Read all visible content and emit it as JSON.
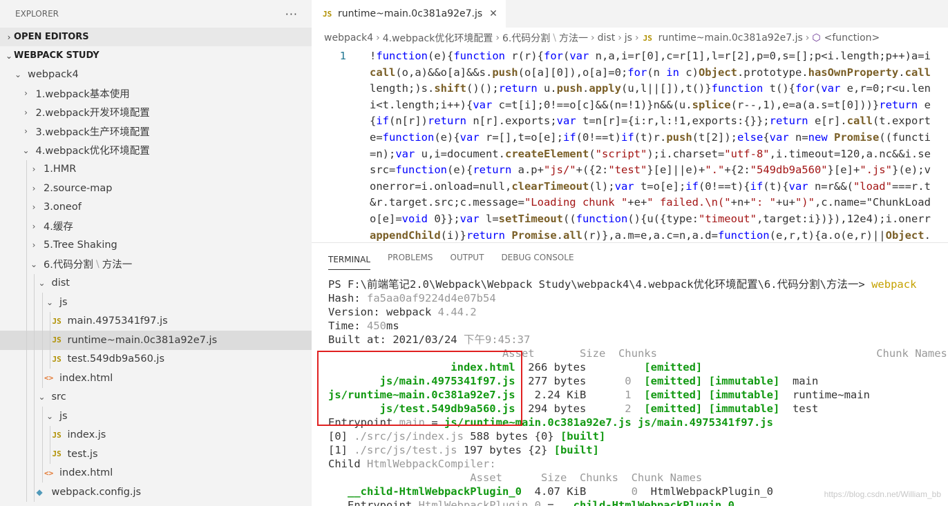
{
  "explorer": {
    "title": "EXPLORER",
    "more": "···",
    "open_editors": "OPEN EDITORS",
    "workspace": "WEBPACK STUDY",
    "tree": [
      {
        "label": "webpack4",
        "type": "folder-open",
        "indent": 0
      },
      {
        "label": "1.webpack基本使用",
        "type": "folder",
        "indent": 1
      },
      {
        "label": "2.webpack开发环境配置",
        "type": "folder",
        "indent": 1
      },
      {
        "label": "3.webpack生产环境配置",
        "type": "folder",
        "indent": 1
      },
      {
        "label": "4.webpack优化环境配置",
        "type": "folder-open",
        "indent": 1
      },
      {
        "label": "1.HMR",
        "type": "folder",
        "indent": 2
      },
      {
        "label": "2.source-map",
        "type": "folder",
        "indent": 2
      },
      {
        "label": "3.oneof",
        "type": "folder",
        "indent": 2
      },
      {
        "label": "4.缓存",
        "type": "folder",
        "indent": 2
      },
      {
        "label": "5.Tree Shaking",
        "type": "folder",
        "indent": 2
      },
      {
        "label": "6.代码分割",
        "suffix": "方法一",
        "type": "folder-open",
        "indent": 2
      },
      {
        "label": "dist",
        "type": "folder-open",
        "indent": 3
      },
      {
        "label": "js",
        "type": "folder-open",
        "indent": 4
      },
      {
        "label": "main.4975341f97.js",
        "type": "js",
        "indent": 5
      },
      {
        "label": "runtime~main.0c381a92e7.js",
        "type": "js",
        "indent": 5,
        "selected": true
      },
      {
        "label": "test.549db9a560.js",
        "type": "js",
        "indent": 5
      },
      {
        "label": "index.html",
        "type": "html",
        "indent": 4
      },
      {
        "label": "src",
        "type": "folder-open",
        "indent": 3
      },
      {
        "label": "js",
        "type": "folder-open",
        "indent": 4
      },
      {
        "label": "index.js",
        "type": "js",
        "indent": 5
      },
      {
        "label": "test.js",
        "type": "js",
        "indent": 5
      },
      {
        "label": "index.html",
        "type": "html",
        "indent": 4
      },
      {
        "label": "webpack.config.js",
        "type": "config",
        "indent": 3
      }
    ]
  },
  "tab": {
    "icon": "JS",
    "label": "runtime~main.0c381a92e7.js",
    "close": "✕"
  },
  "breadcrumb": [
    "webpack4",
    "4.webpack优化环境配置",
    "6.代码分割",
    "方法一",
    "dist",
    "js",
    "runtime~main.0c381a92e7.js",
    "<function>"
  ],
  "code": {
    "line_number": "1",
    "lines": [
      "!function(e){function r(r){for(var n,a,i=r[0],c=r[1],l=r[2],p=0,s=[];p<i.length;p++)a=i",
      "call(o,a)&&o[a]&&s.push(o[a][0]),o[a]=0;for(n in c)Object.prototype.hasOwnProperty.call",
      "length;)s.shift()();return u.push.apply(u,l||[]),t()}function t(){for(var e,r=0;r<u.len",
      "i<t.length;i++){var c=t[i];0!==o[c]&&(n=!1)}n&&(u.splice(r--,1),e=a(a.s=t[0]))}return e",
      "{if(n[r])return n[r].exports;var t=n[r]={i:r,l:!1,exports:{}};return e[r].call(t.export",
      "e=function(e){var r=[],t=o[e];if(0!==t)if(t)r.push(t[2]);else{var n=new Promise((functi",
      "=n);var u,i=document.createElement(\"script\");i.charset=\"utf-8\",i.timeout=120,a.nc&&i.se",
      "src=function(e){return a.p+\"js/\"+({2:\"test\"}[e]||e)+\".\"+{2:\"549db9a560\"}[e]+\".js\"}(e);v",
      "onerror=i.onload=null,clearTimeout(l);var t=o[e];if(0!==t){if(t){var n=r&&(\"load\"===r.t",
      "&r.target.src;c.message=\"Loading chunk \"+e+\" failed.\\n(\"+n+\": \"+u+\")\",c.name=\"ChunkLoad",
      "o[e]=void 0}};var l=setTimeout((function(){u({type:\"timeout\",target:i})}),12e4);i.onerr",
      "appendChild(i)}return Promise.all(r)},a.m=e,a.c=n,a.d=function(e,r,t){a.o(e,r)||Object."
    ]
  },
  "panel": {
    "tabs": [
      "TERMINAL",
      "PROBLEMS",
      "OUTPUT",
      "DEBUG CONSOLE"
    ],
    "active": "TERMINAL"
  },
  "terminal": {
    "prompt": "PS F:\\前端笔记2.0\\Webpack\\Webpack Study\\webpack4\\4.webpack优化环境配置\\6.代码分割\\方法一>",
    "command": "webpack",
    "hash_label": "Hash:",
    "hash": "fa5aa0af9224d4e07b54",
    "version_label": "Version: webpack",
    "version": "4.44.2",
    "time_label": "Time:",
    "time": "450",
    "time_unit": "ms",
    "built_label": "Built at: 2021/03/24",
    "built_time": "下午9:45:37",
    "headers": {
      "asset": "Asset",
      "size": "Size",
      "chunks": "Chunks",
      "names": "Chunk Names"
    },
    "assets": [
      {
        "asset": "index.html",
        "size": "266 bytes",
        "chunk": "",
        "emitted": "[emitted]",
        "immutable": "",
        "name": ""
      },
      {
        "asset": "js/main.4975341f97.js",
        "size": "277 bytes",
        "chunk": "0",
        "emitted": "[emitted]",
        "immutable": "[immutable]",
        "name": "main"
      },
      {
        "asset": "js/runtime~main.0c381a92e7.js",
        "size": "2.24 KiB",
        "chunk": "1",
        "emitted": "[emitted]",
        "immutable": "[immutable]",
        "name": "runtime~main"
      },
      {
        "asset": "js/test.549db9a560.js",
        "size": "294 bytes",
        "chunk": "2",
        "emitted": "[emitted]",
        "immutable": "[immutable]",
        "name": "test"
      }
    ],
    "entrypoint": {
      "label": "Entrypoint",
      "name": "main",
      "eq": "=",
      "files": "js/runtime~main.0c381a92e7.js js/main.4975341f97.js"
    },
    "modules": [
      {
        "id": "[0]",
        "path": "./src/js/index.js",
        "size": "588 bytes",
        "chunk": "{0}",
        "status": "[built]"
      },
      {
        "id": "[1]",
        "path": "./src/js/test.js",
        "size": "197 bytes",
        "chunk": "{2}",
        "status": "[built]"
      }
    ],
    "child_label": "Child",
    "child_name": "HtmlWebpackCompiler:",
    "child_headers": {
      "asset": "Asset",
      "size": "Size",
      "chunks": "Chunks",
      "names": "Chunk Names"
    },
    "child_asset": {
      "asset": "__child-HtmlWebpackPlugin_0",
      "size": "4.07 KiB",
      "chunk": "0",
      "name": "HtmlWebpackPlugin_0"
    },
    "child_entry": {
      "label": "Entrypoint",
      "name": "HtmlWebpackPlugin_0",
      "eq": "=",
      "files": "__child-HtmlWebpackPlugin_0"
    }
  },
  "watermark": "https://blog.csdn.net/William_bb",
  "colors": {
    "highlight_box": "#e02020",
    "terminal_green": "#119911"
  }
}
